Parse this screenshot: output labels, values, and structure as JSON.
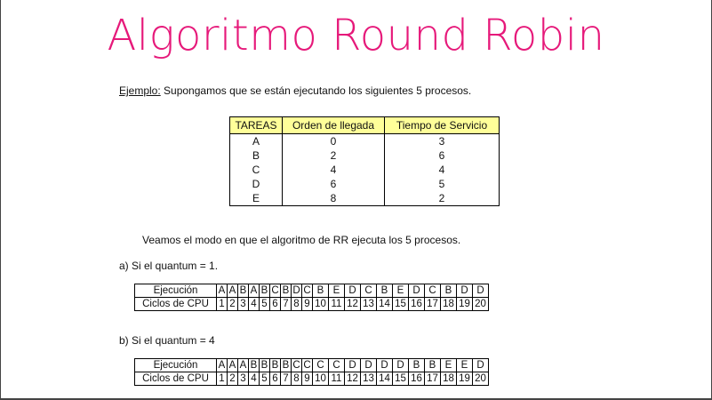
{
  "title": "Algoritmo Round Robin",
  "intro": {
    "label": "Ejemplo:",
    "text": " Supongamos que se están ejecutando los siguientes 5 procesos."
  },
  "tasks_table": {
    "headers": [
      "TAREAS",
      "Orden de llegada",
      "Tiempo de Servicio"
    ],
    "rows": [
      [
        "A",
        "0",
        "3"
      ],
      [
        "B",
        "2",
        "6"
      ],
      [
        "C",
        "4",
        "4"
      ],
      [
        "D",
        "6",
        "5"
      ],
      [
        "E",
        "8",
        "2"
      ]
    ]
  },
  "modo_text": "Veamos el modo en que el algoritmo de RR ejecuta los 5 procesos.",
  "quantum_a": {
    "label": "a) Si el quantum = 1.",
    "row1_label": "Ejecución",
    "row2_label": "Ciclos de CPU",
    "execution": [
      "A",
      "A",
      "B",
      "A",
      "B",
      "C",
      "B",
      "D",
      "C",
      "B",
      "E",
      "D",
      "C",
      "B",
      "E",
      "D",
      "C",
      "B",
      "D",
      "D"
    ],
    "cycles": [
      "1",
      "2",
      "3",
      "4",
      "5",
      "6",
      "7",
      "8",
      "9",
      "10",
      "11",
      "12",
      "13",
      "14",
      "15",
      "16",
      "17",
      "18",
      "19",
      "20"
    ]
  },
  "quantum_b": {
    "label": "b) Si el quantum = 4",
    "row1_label": "Ejecución",
    "row2_label": "Ciclos de CPU",
    "execution": [
      "A",
      "A",
      "A",
      "B",
      "B",
      "B",
      "B",
      "C",
      "C",
      "C",
      "C",
      "D",
      "D",
      "D",
      "D",
      "B",
      "B",
      "E",
      "E",
      "D"
    ],
    "cycles": [
      "1",
      "2",
      "3",
      "4",
      "5",
      "6",
      "7",
      "8",
      "9",
      "10",
      "11",
      "12",
      "13",
      "14",
      "15",
      "16",
      "17",
      "18",
      "19",
      "20"
    ]
  }
}
